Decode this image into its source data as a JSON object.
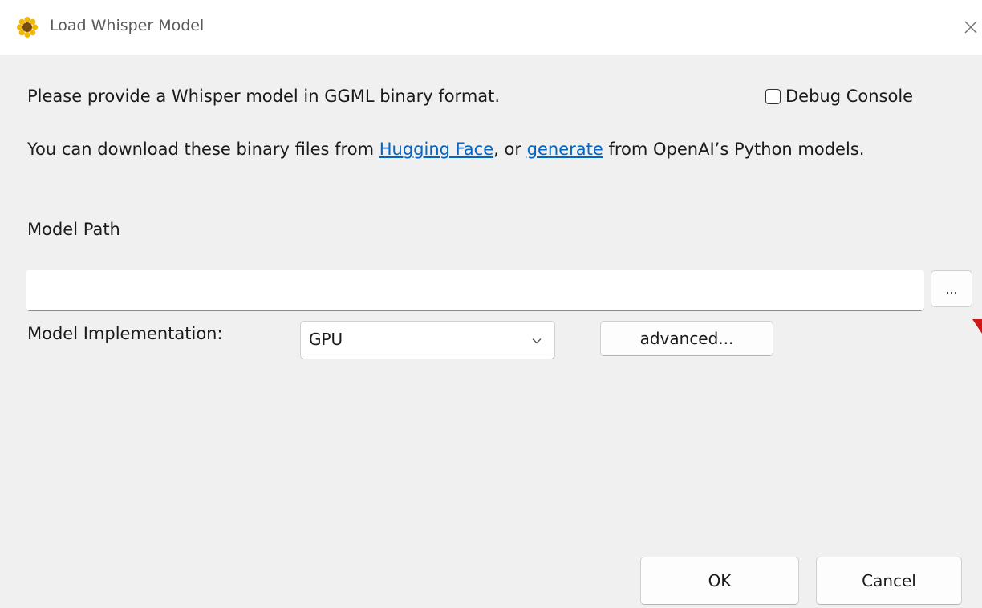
{
  "window": {
    "title": "Load Whisper Model",
    "accent": "#0563c1"
  },
  "content": {
    "intro": "Please provide a Whisper model in GGML binary format.",
    "info_prefix": "You can download these binary files from ",
    "link_huggingface": "Hugging Face",
    "info_middle": ", or ",
    "link_generate": "generate",
    "info_suffix": " from OpenAI’s Python models.",
    "model_path_label": "Model Path",
    "model_path_value": "",
    "browse_label": "...",
    "impl_label": "Model Implementation:",
    "impl_selected": "GPU",
    "advanced_label": "advanced...",
    "debug_console_label": "Debug Console",
    "debug_console_checked": false,
    "ok_label": "OK",
    "cancel_label": "Cancel"
  },
  "icons": {
    "app": "sunflower-icon",
    "close": "close-icon",
    "dropdown": "chevron-down-icon"
  }
}
